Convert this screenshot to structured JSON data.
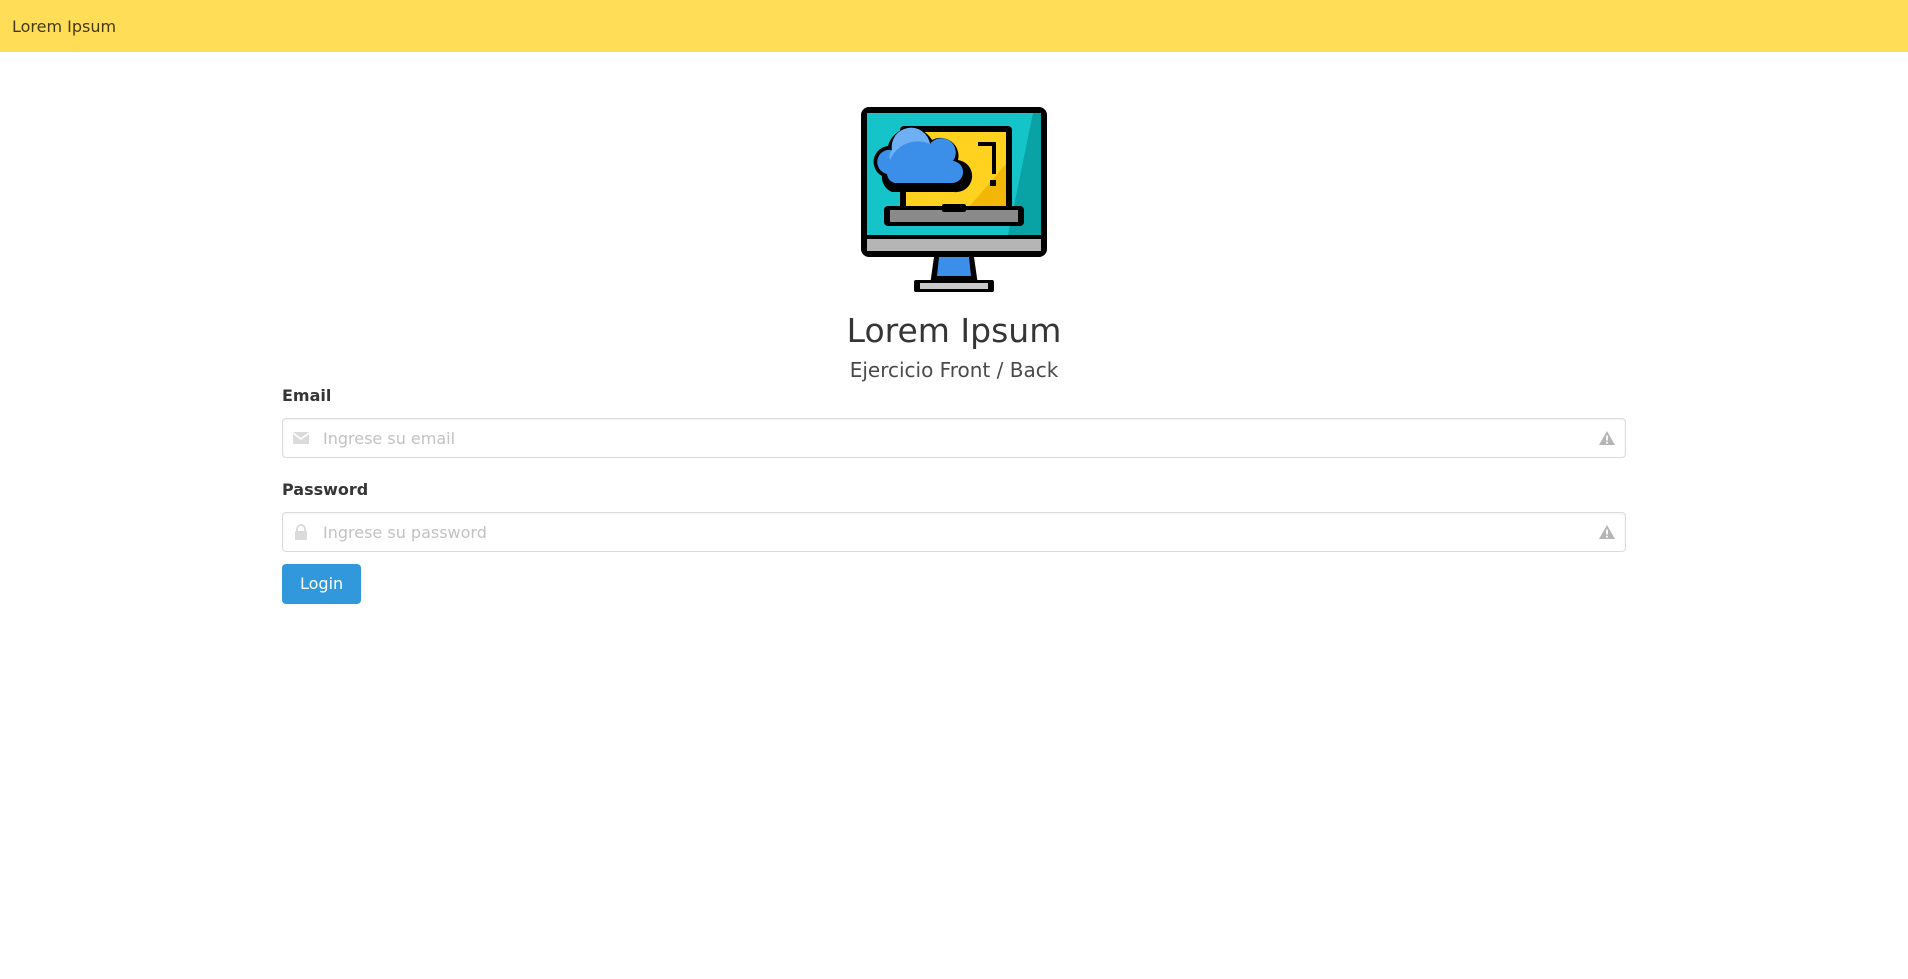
{
  "navbar": {
    "brand": "Lorem Ipsum"
  },
  "hero": {
    "logo_icon": "computer-cloud-icon",
    "title": "Lorem Ipsum",
    "subtitle": "Ejercicio Front / Back"
  },
  "form": {
    "email": {
      "label": "Email",
      "placeholder": "Ingrese su email",
      "value": "",
      "left_icon": "envelope-icon",
      "right_icon": "warning-icon"
    },
    "password": {
      "label": "Password",
      "placeholder": "Ingrese su password",
      "value": "",
      "left_icon": "lock-icon",
      "right_icon": "warning-icon"
    },
    "submit_label": "Login"
  },
  "colors": {
    "navbar_bg": "#ffdd57",
    "button_bg": "#3298dc",
    "input_border": "#dbdbdb"
  }
}
